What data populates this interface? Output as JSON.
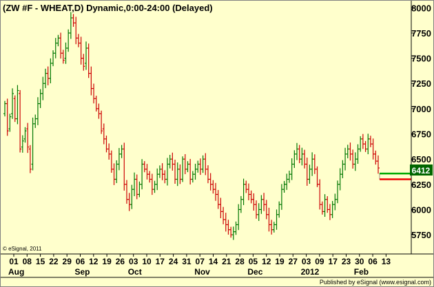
{
  "title": "(ZW #F - WHEAT,D) Dynamic,0:00-24:00 (Delayed)",
  "copyright": "© eSignal, 2011",
  "footer": "Published by eSignal (www.esignal.com)",
  "last_price_label": "6412",
  "colors": {
    "background": "#ffffcc",
    "up_bar": "#007700",
    "down_bar": "#cc0000",
    "last_price_box": "#006600",
    "last_price_line": "#00aa00",
    "reference_line": "#ee0000"
  },
  "chart_data": {
    "type": "ohlc",
    "title": "(ZW #F - WHEAT,D) Dynamic,0:00-24:00 (Delayed)",
    "xlabel": "",
    "ylabel": "",
    "ylim": [
      5580,
      8050
    ],
    "y_ticks": [
      5750,
      6000,
      6250,
      6500,
      6750,
      7000,
      7250,
      7500,
      7750,
      8000
    ],
    "x_tick_labels": [
      "01",
      "08",
      "15",
      "22",
      "29",
      "06",
      "12",
      "19",
      "26",
      "03",
      "10",
      "17",
      "24",
      "31",
      "07",
      "14",
      "21",
      "28",
      "05",
      "12",
      "19",
      "27",
      "03",
      "09",
      "17",
      "23",
      "30",
      "06",
      "13"
    ],
    "month_labels": [
      {
        "label": "Aug",
        "tick_index": 0
      },
      {
        "label": "Sep",
        "tick_index": 5
      },
      {
        "label": "Oct",
        "tick_index": 9
      },
      {
        "label": "Nov",
        "tick_index": 14
      },
      {
        "label": "Dec",
        "tick_index": 18
      },
      {
        "label": "2012",
        "tick_index": 22
      },
      {
        "label": "Feb",
        "tick_index": 26
      }
    ],
    "last_price": 6412,
    "reference_level": 6300,
    "close": [
      7050,
      6780,
      6920,
      7150,
      6900,
      7180,
      6600,
      6680,
      6780,
      6620,
      6400,
      6850,
      6900,
      7050,
      7150,
      7250,
      7350,
      7300,
      7450,
      7550,
      7650,
      7700,
      7550,
      7480,
      7600,
      7750,
      7900,
      7850,
      7700,
      7650,
      7500,
      7420,
      7600,
      7350,
      7200,
      7100,
      7000,
      6950,
      6780,
      6700,
      6600,
      6550,
      6400,
      6300,
      6450,
      6550,
      6600,
      6250,
      6100,
      6050,
      6200,
      6300,
      6150,
      6250,
      6450,
      6400,
      6350,
      6300,
      6200,
      6250,
      6350,
      6400,
      6350,
      6300,
      6450,
      6500,
      6450,
      6300,
      6400,
      6300,
      6500,
      6400,
      6450,
      6300,
      6350,
      6400,
      6450,
      6400,
      6500,
      6400,
      6300,
      6250,
      6200,
      6150,
      6050,
      5980,
      5900,
      5850,
      5800,
      5750,
      5780,
      5850,
      6000,
      6100,
      6250,
      6200,
      6150,
      6100,
      6050,
      5950,
      6000,
      6100,
      6050,
      5950,
      5850,
      5800,
      5850,
      5950,
      6050,
      6200,
      6250,
      6300,
      6350,
      6450,
      6550,
      6600,
      6500,
      6550,
      6450,
      6300,
      6400,
      6500,
      6400,
      6250,
      6050,
      5980,
      6100,
      6000,
      5950,
      6050,
      6100,
      6250,
      6350,
      6450,
      6550,
      6600,
      6550,
      6450,
      6500,
      6600,
      6700,
      6650,
      6600,
      6700,
      6650,
      6550,
      6480,
      6412
    ],
    "open": [
      6950,
      7050,
      6800,
      6950,
      7100,
      6900,
      7150,
      6620,
      6700,
      6800,
      6600,
      6450,
      6850,
      6900,
      7050,
      7150,
      7250,
      7350,
      7300,
      7450,
      7550,
      7650,
      7700,
      7550,
      7500,
      7600,
      7750,
      7900,
      7850,
      7700,
      7650,
      7500,
      7450,
      7600,
      7350,
      7200,
      7100,
      7000,
      6950,
      6800,
      6700,
      6600,
      6550,
      6400,
      6300,
      6450,
      6550,
      6600,
      6250,
      6100,
      6050,
      6200,
      6300,
      6150,
      6250,
      6450,
      6400,
      6350,
      6300,
      6200,
      6250,
      6350,
      6400,
      6350,
      6300,
      6450,
      6500,
      6450,
      6300,
      6400,
      6300,
      6500,
      6400,
      6450,
      6300,
      6350,
      6400,
      6450,
      6400,
      6500,
      6400,
      6300,
      6250,
      6200,
      6150,
      6050,
      5980,
      5900,
      5850,
      5800,
      5750,
      5780,
      5850,
      6000,
      6100,
      6250,
      6200,
      6150,
      6100,
      6050,
      5950,
      6000,
      6100,
      6050,
      5950,
      5850,
      5800,
      5850,
      5950,
      6050,
      6200,
      6250,
      6300,
      6350,
      6450,
      6550,
      6600,
      6500,
      6550,
      6450,
      6300,
      6400,
      6500,
      6400,
      6250,
      6050,
      5980,
      6100,
      6000,
      5950,
      6050,
      6100,
      6250,
      6350,
      6450,
      6550,
      6600,
      6550,
      6450,
      6500,
      6600,
      6700,
      6650,
      6600,
      6700,
      6650,
      6550,
      6480
    ]
  }
}
